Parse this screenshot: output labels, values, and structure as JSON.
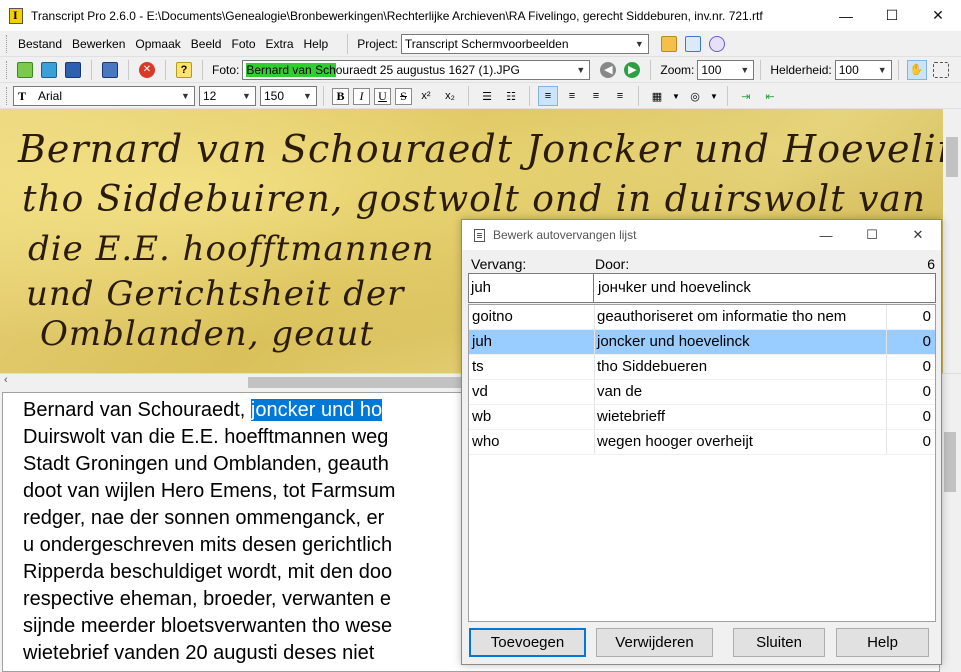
{
  "window": {
    "title": "Transcript Pro 2.6.0 - E:\\Documents\\Genealogie\\Bronbewerkingen\\Rechterlijke Archieven\\RA Fivelingo, gerecht Siddeburen, inv.nr. 721.rtf",
    "minimize": "—",
    "maximize": "☐",
    "close": "✕"
  },
  "menu": {
    "items": [
      "Bestand",
      "Bewerken",
      "Opmaak",
      "Beeld",
      "Foto",
      "Extra",
      "Help"
    ],
    "project_label": "Project:",
    "project_value": "Transcript Schermvoorbeelden"
  },
  "toolbar2": {
    "foto_label": "Foto:",
    "foto_highlight": "Bernard van Sch",
    "foto_rest": "ouraedt 25 augustus 1627 (1).JPG",
    "zoom_label": "Zoom:",
    "zoom_value": "100",
    "helderheid_label": "Helderheid:",
    "helderheid_value": "100"
  },
  "toolbar3": {
    "font": "Arial",
    "size": "12",
    "zoom": "150",
    "bold": "B",
    "italic": "I",
    "underline": "U",
    "strike": "S",
    "superscript": "x²",
    "subscript": "x₂"
  },
  "manuscript": {
    "lines": [
      "Bernard van Schouraedt Joncker und Hoevelinck",
      "tho Siddebuiren, gostwolt ond in duirswolt van",
      "die E.E. hoofftmannen",
      "und Gerichtsheit der",
      "Omblanden, geaut"
    ]
  },
  "editor": {
    "line1_prefix": "Bernard van Schouraedt, ",
    "line1_selected": "joncker und ho",
    "lines": [
      "Duirswolt van die E.E. hoefftmannen weg",
      "Stadt Groningen und Omblanden, geauth",
      "doot van wijlen Hero Emens, tot Farmsum",
      "redger, nae der sonnen ommenganck, er",
      "u ondergeschreven mits desen gerichtlich",
      "Ripperda beschuldiget wordt, mit den doo",
      "respective eheman, broeder, verwanten e",
      "sijnde meerder bloetsverwanten tho wese",
      "wietebrief vanden 20 augusti deses niet"
    ]
  },
  "dialog": {
    "title": "Bewerk autovervangen lijst",
    "col_vervang": "Vervang:",
    "col_door": "Door:",
    "count": "6",
    "input_vervang": "juh",
    "input_door": "jончker und hoevelinck",
    "rows": [
      {
        "key": "goitno",
        "value": "geauthoriseret om informatie tho nem",
        "count": "0"
      },
      {
        "key": "juh",
        "value": "joncker und hoevelinck",
        "count": "0"
      },
      {
        "key": "ts",
        "value": "tho Siddebueren",
        "count": "0"
      },
      {
        "key": "vd",
        "value": "van de",
        "count": "0"
      },
      {
        "key": "wb",
        "value": "wietebrieff",
        "count": "0"
      },
      {
        "key": "who",
        "value": "wegen hooger overheijt",
        "count": "0"
      }
    ],
    "selected_index": 1,
    "buttons": {
      "add": "Toevoegen",
      "delete": "Verwijderen",
      "close": "Sluiten",
      "help": "Help"
    }
  },
  "colors": {
    "selection": "#0078d7",
    "list_selection": "#99ccff",
    "photo_highlight": "#33cc33"
  }
}
